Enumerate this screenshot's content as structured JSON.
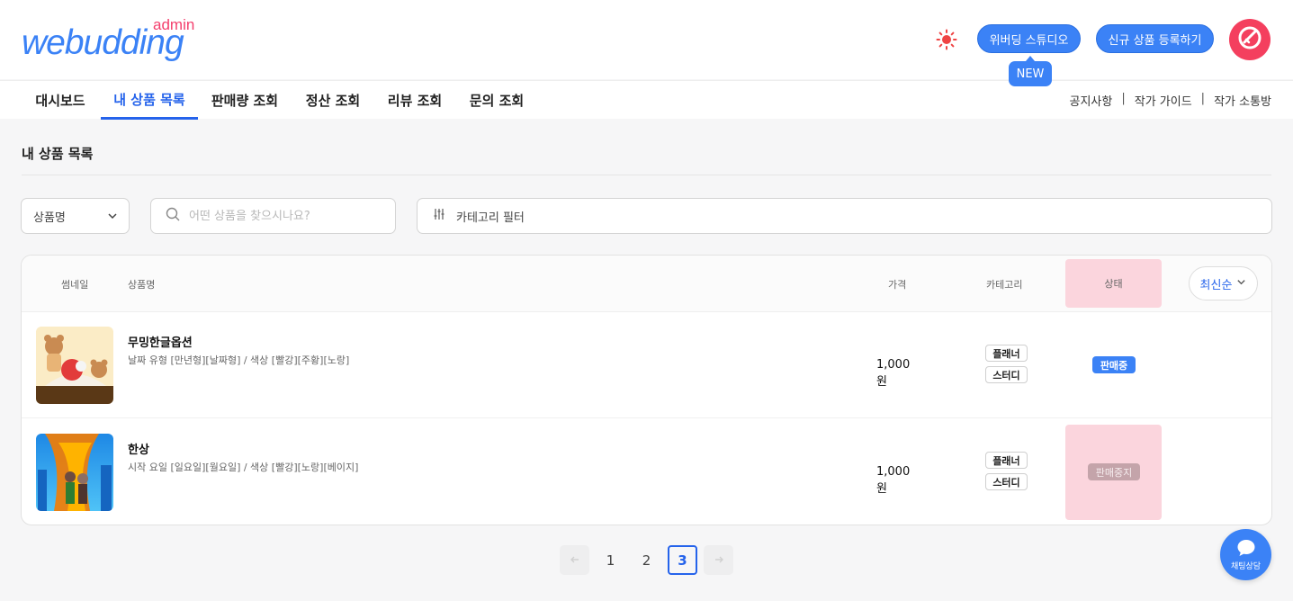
{
  "header": {
    "logo_main": "webudding",
    "logo_sub": "admin",
    "theme_icon": "sun-icon",
    "studio_button": "위버딩 스튜디오",
    "new_badge": "NEW",
    "register_button": "신규 상품 등록하기",
    "avatar_icon": "brand-avatar-icon"
  },
  "nav": {
    "tabs": [
      {
        "label": "대시보드"
      },
      {
        "label": "내 상품 목록"
      },
      {
        "label": "판매량 조회"
      },
      {
        "label": "정산 조회"
      },
      {
        "label": "리뷰 조회"
      },
      {
        "label": "문의 조회"
      }
    ],
    "active_tab": "내 상품 목록",
    "links": [
      {
        "label": "공지사항"
      },
      {
        "label": "작가 가이드"
      },
      {
        "label": "작가 소통방"
      }
    ],
    "link_separator": "|"
  },
  "page": {
    "title": "내 상품 목록"
  },
  "filters": {
    "search_field_select": "상품명",
    "search_placeholder": "어떤 상품을 찾으시나요?",
    "category_filter": "카테고리 필터"
  },
  "table": {
    "columns": {
      "thumbnail": "썸네일",
      "name": "상품명",
      "price": "가격",
      "category": "카테고리",
      "status": "상태"
    },
    "sort_label": "최신순",
    "rows": [
      {
        "name": "무밍한글옵션",
        "options": "날짜 유형 [만년형][날짜형] / 색상 [빨강][주황][노랑]",
        "price": "1,000원",
        "categories": [
          "플래너",
          "스터디"
        ],
        "status": "판매중"
      },
      {
        "name": "한상",
        "options": "시작 요일 [일요일][월요일] / 색상 [빨강][노랑][베이지]",
        "price": "1,000원",
        "categories": [
          "플래너",
          "스터디"
        ],
        "status": "판매중지"
      }
    ]
  },
  "pagination": {
    "pages": [
      "1",
      "2",
      "3"
    ],
    "current": "3",
    "prev_icon": "arrow-left-icon",
    "next_icon": "arrow-right-icon"
  },
  "chat": {
    "label": "채팅상담",
    "icon": "chat-bubble-icon"
  },
  "colors": {
    "primary": "#3b82f6",
    "accent_pink": "#f43f5e",
    "status_stopped_bg": "#fbd5dd"
  }
}
